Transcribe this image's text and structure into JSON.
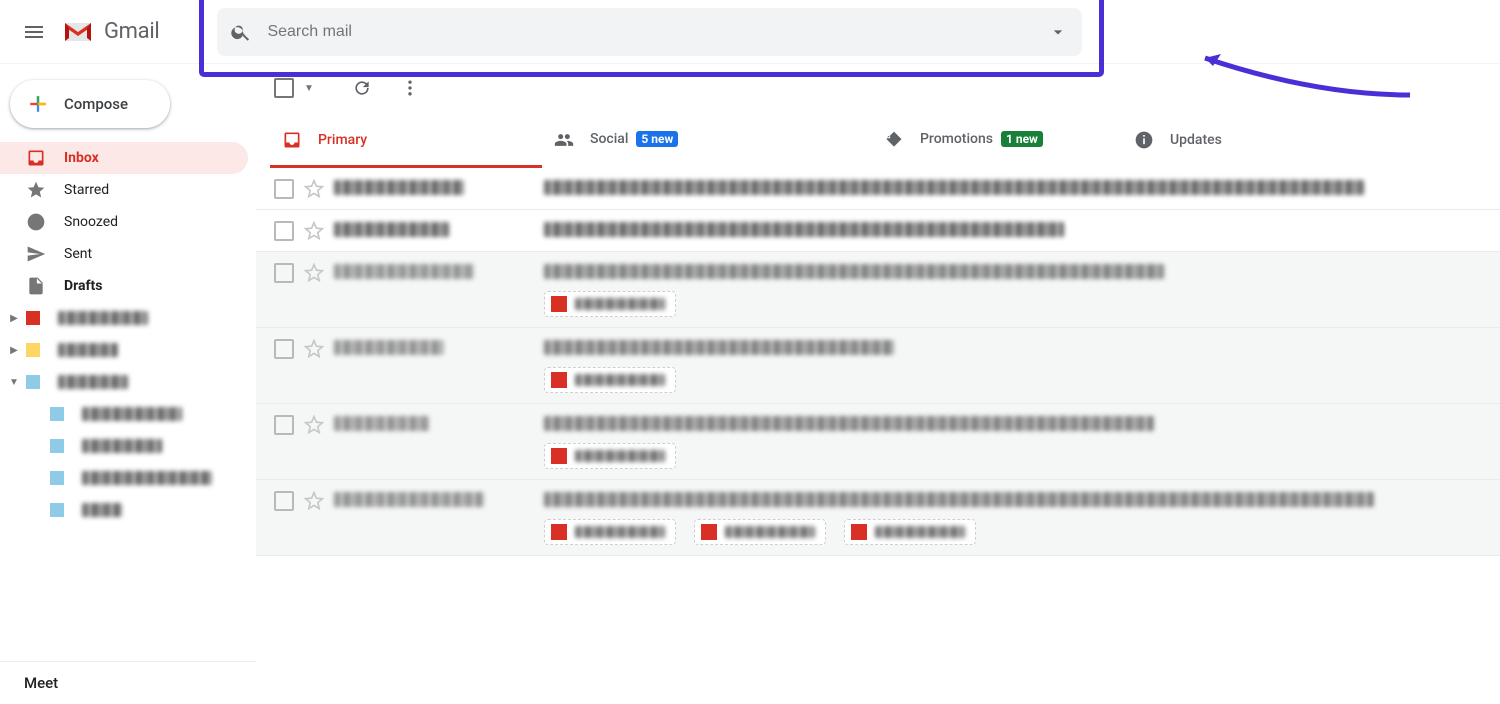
{
  "header": {
    "app_name": "Gmail",
    "search_placeholder": "Search mail"
  },
  "compose_label": "Compose",
  "sidebar": {
    "items": [
      {
        "icon": "inbox",
        "label": "Inbox",
        "active": true,
        "bold": true
      },
      {
        "icon": "star",
        "label": "Starred",
        "active": false,
        "bold": false
      },
      {
        "icon": "snooze",
        "label": "Snoozed",
        "active": false,
        "bold": false
      },
      {
        "icon": "sent",
        "label": "Sent",
        "active": false,
        "bold": false
      },
      {
        "icon": "drafts",
        "label": "Drafts",
        "active": false,
        "bold": true
      }
    ],
    "labels": [
      {
        "expanded": false,
        "color": "#d93025"
      },
      {
        "expanded": false,
        "color": "#fdd663"
      },
      {
        "expanded": true,
        "color": "#8ecbe7"
      }
    ],
    "sublabels": [
      {
        "color": "#8ecbe7"
      },
      {
        "color": "#8ecbe7"
      },
      {
        "color": "#8ecbe7"
      },
      {
        "color": "#8ecbe7"
      }
    ],
    "meet_label": "Meet"
  },
  "tabs": [
    {
      "key": "primary",
      "label": "Primary",
      "active": true,
      "badge": null,
      "icon": "primary"
    },
    {
      "key": "social",
      "label": "Social",
      "active": false,
      "badge": {
        "text": "5 new",
        "style": "blue"
      },
      "icon": "social"
    },
    {
      "key": "promotions",
      "label": "Promotions",
      "active": false,
      "badge": {
        "text": "1 new",
        "style": "green"
      },
      "icon": "promotions"
    },
    {
      "key": "updates",
      "label": "Updates",
      "active": false,
      "badge": null,
      "icon": "updates"
    }
  ],
  "rows": [
    {
      "read": false,
      "attachments": 0
    },
    {
      "read": false,
      "attachments": 0
    },
    {
      "read": true,
      "attachments": 1
    },
    {
      "read": true,
      "attachments": 1
    },
    {
      "read": true,
      "attachments": 1
    },
    {
      "read": true,
      "attachments": 3
    }
  ]
}
